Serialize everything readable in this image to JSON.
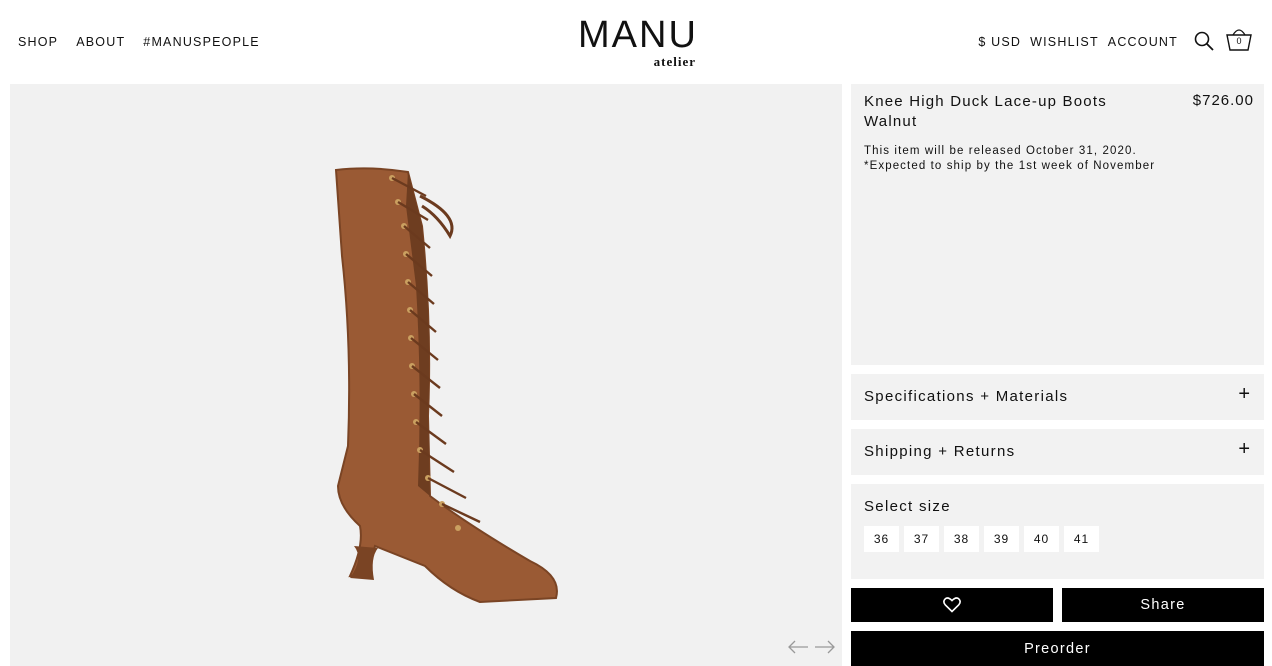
{
  "header": {
    "nav_left": [
      "SHOP",
      "ABOUT",
      "#MANUSPEOPLE"
    ],
    "logo": {
      "mark": "MANU",
      "sub": "atelier"
    },
    "nav_right": [
      "$ USD",
      "WISHLIST",
      "ACCOUNT"
    ],
    "cart_count": "0"
  },
  "product": {
    "title": "Knee High Duck Lace-up Boots Walnut",
    "price": "$726.00",
    "release_note": "This item will be released October 31, 2020.",
    "ship_note": "*Expected to ship by the 1st week of November",
    "image_color": "#9a5a34"
  },
  "accordions": {
    "spec": "Specifications + Materials",
    "ship": "Shipping + Returns"
  },
  "sizes": {
    "label": "Select size",
    "options": [
      "36",
      "37",
      "38",
      "39",
      "40",
      "41"
    ]
  },
  "actions": {
    "share": "Share",
    "preorder": "Preorder"
  },
  "icons": [
    "search-icon",
    "cart-icon",
    "heart-icon",
    "arrow-left-icon",
    "arrow-right-icon",
    "plus-icon"
  ]
}
